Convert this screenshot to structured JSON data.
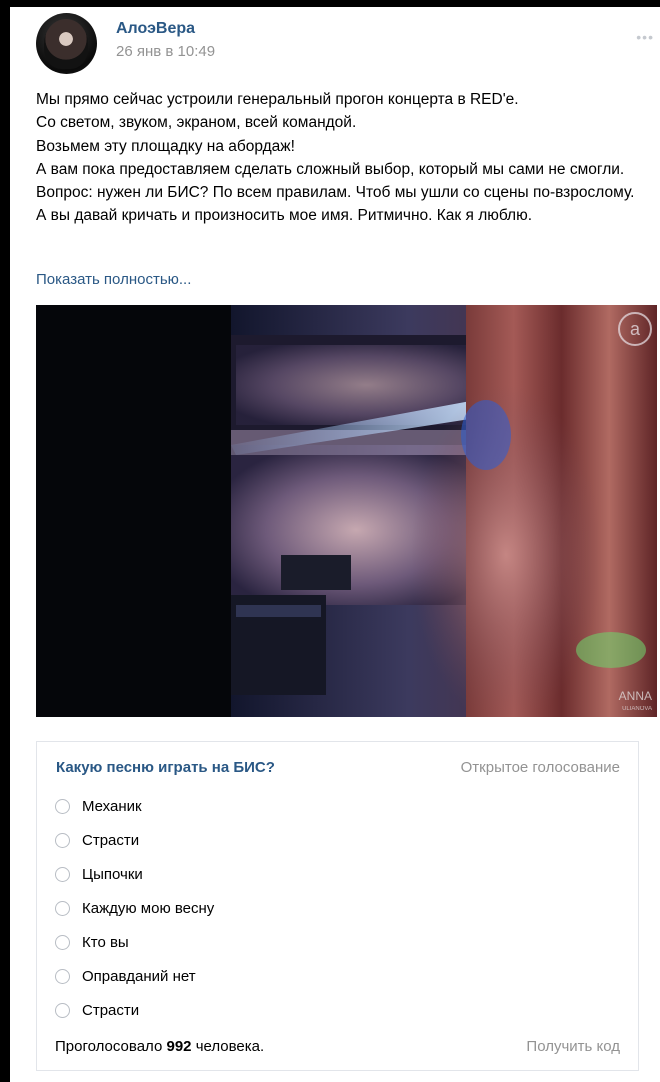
{
  "post": {
    "author": "АлоэВера",
    "date": "26 янв в 10:49",
    "more_icon": "•••",
    "lines": [
      "Мы прямо сейчас устроили генеральный прогон концерта в RED'е.",
      "Со светом, звуком, экраном, всей командой.",
      "Возьмем эту площадку на абордаж!",
      "А вам пока предоставляем сделать сложный выбор, который мы сами не смогли.",
      "Вопрос: нужен ли БИС? По всем правилам. Чтоб мы ушли со сцены по-взрослому. А вы давай кричать и произносить мое имя. Ритмично. Как я люблю."
    ],
    "show_more": "Показать полностью...",
    "photo_watermark": "ANNA",
    "photo_watermark_sub": "ULIANOVA",
    "photo_logo": "a"
  },
  "poll": {
    "question": "Какую песню играть на БИС?",
    "type": "Открытое голосование",
    "options": [
      "Механик",
      "Страсти",
      "Цыпочки",
      "Каждую мою весну",
      "Кто вы",
      "Оправданий нет",
      "Страсти"
    ],
    "votes_prefix": "Проголосовало",
    "votes_count": "992",
    "votes_suffix": "человека.",
    "get_code": "Получить код"
  }
}
